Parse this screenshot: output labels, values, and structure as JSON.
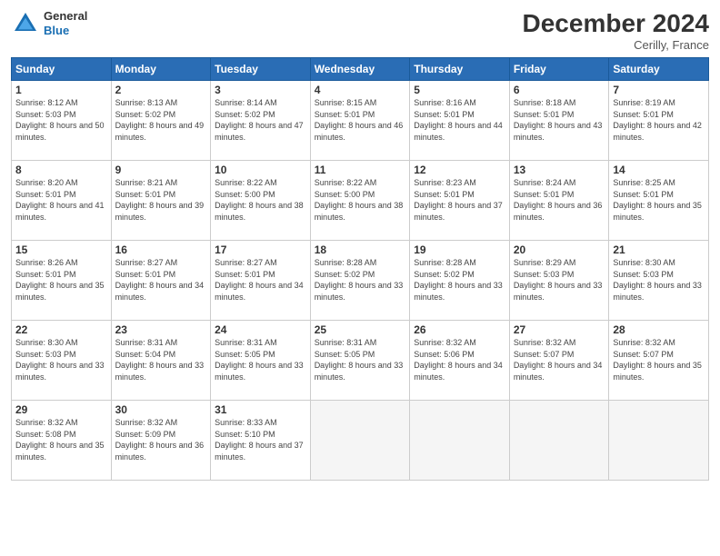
{
  "header": {
    "logo_general": "General",
    "logo_blue": "Blue",
    "month_title": "December 2024",
    "location": "Cerilly, France"
  },
  "weekdays": [
    "Sunday",
    "Monday",
    "Tuesday",
    "Wednesday",
    "Thursday",
    "Friday",
    "Saturday"
  ],
  "days": [
    {
      "num": "",
      "info": ""
    },
    {
      "num": "",
      "info": ""
    },
    {
      "num": "",
      "info": ""
    },
    {
      "num": "",
      "info": ""
    },
    {
      "num": "",
      "info": ""
    },
    {
      "num": "",
      "info": ""
    },
    {
      "num": "1",
      "sunrise": "Sunrise: 8:12 AM",
      "sunset": "Sunset: 5:03 PM",
      "daylight": "Daylight: 8 hours and 50 minutes."
    },
    {
      "num": "2",
      "sunrise": "Sunrise: 8:13 AM",
      "sunset": "Sunset: 5:02 PM",
      "daylight": "Daylight: 8 hours and 49 minutes."
    },
    {
      "num": "3",
      "sunrise": "Sunrise: 8:14 AM",
      "sunset": "Sunset: 5:02 PM",
      "daylight": "Daylight: 8 hours and 47 minutes."
    },
    {
      "num": "4",
      "sunrise": "Sunrise: 8:15 AM",
      "sunset": "Sunset: 5:01 PM",
      "daylight": "Daylight: 8 hours and 46 minutes."
    },
    {
      "num": "5",
      "sunrise": "Sunrise: 8:16 AM",
      "sunset": "Sunset: 5:01 PM",
      "daylight": "Daylight: 8 hours and 44 minutes."
    },
    {
      "num": "6",
      "sunrise": "Sunrise: 8:18 AM",
      "sunset": "Sunset: 5:01 PM",
      "daylight": "Daylight: 8 hours and 43 minutes."
    },
    {
      "num": "7",
      "sunrise": "Sunrise: 8:19 AM",
      "sunset": "Sunset: 5:01 PM",
      "daylight": "Daylight: 8 hours and 42 minutes."
    },
    {
      "num": "8",
      "sunrise": "Sunrise: 8:20 AM",
      "sunset": "Sunset: 5:01 PM",
      "daylight": "Daylight: 8 hours and 41 minutes."
    },
    {
      "num": "9",
      "sunrise": "Sunrise: 8:21 AM",
      "sunset": "Sunset: 5:01 PM",
      "daylight": "Daylight: 8 hours and 39 minutes."
    },
    {
      "num": "10",
      "sunrise": "Sunrise: 8:22 AM",
      "sunset": "Sunset: 5:00 PM",
      "daylight": "Daylight: 8 hours and 38 minutes."
    },
    {
      "num": "11",
      "sunrise": "Sunrise: 8:22 AM",
      "sunset": "Sunset: 5:00 PM",
      "daylight": "Daylight: 8 hours and 38 minutes."
    },
    {
      "num": "12",
      "sunrise": "Sunrise: 8:23 AM",
      "sunset": "Sunset: 5:01 PM",
      "daylight": "Daylight: 8 hours and 37 minutes."
    },
    {
      "num": "13",
      "sunrise": "Sunrise: 8:24 AM",
      "sunset": "Sunset: 5:01 PM",
      "daylight": "Daylight: 8 hours and 36 minutes."
    },
    {
      "num": "14",
      "sunrise": "Sunrise: 8:25 AM",
      "sunset": "Sunset: 5:01 PM",
      "daylight": "Daylight: 8 hours and 35 minutes."
    },
    {
      "num": "15",
      "sunrise": "Sunrise: 8:26 AM",
      "sunset": "Sunset: 5:01 PM",
      "daylight": "Daylight: 8 hours and 35 minutes."
    },
    {
      "num": "16",
      "sunrise": "Sunrise: 8:27 AM",
      "sunset": "Sunset: 5:01 PM",
      "daylight": "Daylight: 8 hours and 34 minutes."
    },
    {
      "num": "17",
      "sunrise": "Sunrise: 8:27 AM",
      "sunset": "Sunset: 5:01 PM",
      "daylight": "Daylight: 8 hours and 34 minutes."
    },
    {
      "num": "18",
      "sunrise": "Sunrise: 8:28 AM",
      "sunset": "Sunset: 5:02 PM",
      "daylight": "Daylight: 8 hours and 33 minutes."
    },
    {
      "num": "19",
      "sunrise": "Sunrise: 8:28 AM",
      "sunset": "Sunset: 5:02 PM",
      "daylight": "Daylight: 8 hours and 33 minutes."
    },
    {
      "num": "20",
      "sunrise": "Sunrise: 8:29 AM",
      "sunset": "Sunset: 5:03 PM",
      "daylight": "Daylight: 8 hours and 33 minutes."
    },
    {
      "num": "21",
      "sunrise": "Sunrise: 8:30 AM",
      "sunset": "Sunset: 5:03 PM",
      "daylight": "Daylight: 8 hours and 33 minutes."
    },
    {
      "num": "22",
      "sunrise": "Sunrise: 8:30 AM",
      "sunset": "Sunset: 5:03 PM",
      "daylight": "Daylight: 8 hours and 33 minutes."
    },
    {
      "num": "23",
      "sunrise": "Sunrise: 8:31 AM",
      "sunset": "Sunset: 5:04 PM",
      "daylight": "Daylight: 8 hours and 33 minutes."
    },
    {
      "num": "24",
      "sunrise": "Sunrise: 8:31 AM",
      "sunset": "Sunset: 5:05 PM",
      "daylight": "Daylight: 8 hours and 33 minutes."
    },
    {
      "num": "25",
      "sunrise": "Sunrise: 8:31 AM",
      "sunset": "Sunset: 5:05 PM",
      "daylight": "Daylight: 8 hours and 33 minutes."
    },
    {
      "num": "26",
      "sunrise": "Sunrise: 8:32 AM",
      "sunset": "Sunset: 5:06 PM",
      "daylight": "Daylight: 8 hours and 34 minutes."
    },
    {
      "num": "27",
      "sunrise": "Sunrise: 8:32 AM",
      "sunset": "Sunset: 5:07 PM",
      "daylight": "Daylight: 8 hours and 34 minutes."
    },
    {
      "num": "28",
      "sunrise": "Sunrise: 8:32 AM",
      "sunset": "Sunset: 5:07 PM",
      "daylight": "Daylight: 8 hours and 35 minutes."
    },
    {
      "num": "29",
      "sunrise": "Sunrise: 8:32 AM",
      "sunset": "Sunset: 5:08 PM",
      "daylight": "Daylight: 8 hours and 35 minutes."
    },
    {
      "num": "30",
      "sunrise": "Sunrise: 8:32 AM",
      "sunset": "Sunset: 5:09 PM",
      "daylight": "Daylight: 8 hours and 36 minutes."
    },
    {
      "num": "31",
      "sunrise": "Sunrise: 8:33 AM",
      "sunset": "Sunset: 5:10 PM",
      "daylight": "Daylight: 8 hours and 37 minutes."
    },
    {
      "num": "",
      "info": ""
    },
    {
      "num": "",
      "info": ""
    },
    {
      "num": "",
      "info": ""
    },
    {
      "num": "",
      "info": ""
    },
    {
      "num": "",
      "info": ""
    },
    {
      "num": "",
      "info": ""
    }
  ]
}
